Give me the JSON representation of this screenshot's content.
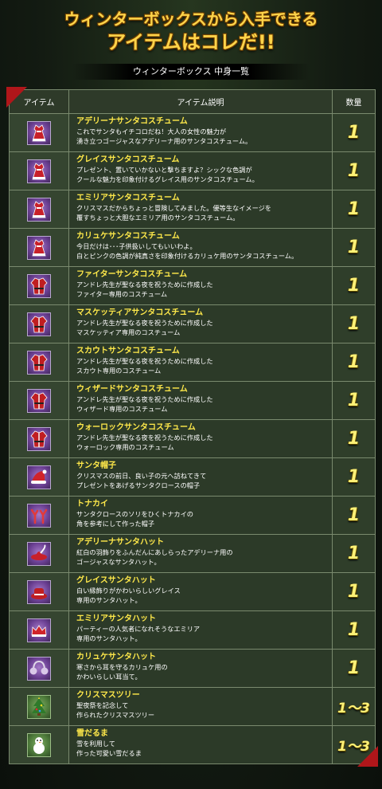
{
  "header": {
    "line1": "ウィンターボックスから入手できる",
    "line2": "アイテムはコレだ!!",
    "subtitle": "ウィンターボックス 中身一覧"
  },
  "table": {
    "col_icon": "アイテム",
    "col_desc": "アイテム説明",
    "col_qty": "数量",
    "rows": [
      {
        "name": "アデリーナサンタコスチューム",
        "d1": "これでサンタもイチコロだね！大人の女性の魅力が",
        "d2": "湧き立つゴージャスなアデリーナ用のサンタコスチューム。",
        "qty": "1",
        "icon": "dress-icon"
      },
      {
        "name": "グレイスサンタコスチューム",
        "d1": "プレゼント、置いていかないと撃ちますよ？シックな色調が",
        "d2": "クールな魅力を印象付けるグレイス用のサンタコスチューム。",
        "qty": "1",
        "icon": "dress-icon"
      },
      {
        "name": "エミリアサンタコスチューム",
        "d1": "クリスマスだからちょっと冒険してみました。優等生なイメージを",
        "d2": "覆すちょっと大胆なエミリア用のサンタコスチューム。",
        "qty": "1",
        "icon": "dress-icon"
      },
      {
        "name": "カリュケサンタコスチューム",
        "d1": "今日だけは･･･子供扱いしてもいいわよ。",
        "d2": "白とピンクの色調が純真さを印象付けるカリュケ用のサンタコスチューム。",
        "qty": "1",
        "icon": "dress-icon"
      },
      {
        "name": "ファイターサンタコスチューム",
        "d1": "アンドレ先生が聖なる夜を祝うために作成した",
        "d2": "ファイター専用のコスチューム",
        "qty": "1",
        "icon": "coat-icon"
      },
      {
        "name": "マスケッティアサンタコスチューム",
        "d1": "アンドレ先生が聖なる夜を祝うために作成した",
        "d2": "マスケッティア専用のコスチューム",
        "qty": "1",
        "icon": "coat-icon"
      },
      {
        "name": "スカウトサンタコスチューム",
        "d1": "アンドレ先生が聖なる夜を祝うために作成した",
        "d2": "スカウト専用のコスチューム",
        "qty": "1",
        "icon": "coat-icon"
      },
      {
        "name": "ウィザードサンタコスチューム",
        "d1": "アンドレ先生が聖なる夜を祝うために作成した",
        "d2": "ウィザード専用のコスチューム",
        "qty": "1",
        "icon": "coat-icon"
      },
      {
        "name": "ウォーロックサンタコスチューム",
        "d1": "アンドレ先生が聖なる夜を祝うために作成した",
        "d2": "ウォーロック専用のコスチューム",
        "qty": "1",
        "icon": "coat-icon"
      },
      {
        "name": "サンタ帽子",
        "d1": "クリスマスの前日、良い子の元へ訪ねてきて",
        "d2": "プレゼントをあげるサンタクロースの帽子",
        "qty": "1",
        "icon": "santa-hat-icon"
      },
      {
        "name": "トナカイ",
        "d1": "サンタクロースのソリをひくトナカイの",
        "d2": "角を参考にして作った帽子",
        "qty": "1",
        "icon": "antler-icon"
      },
      {
        "name": "アデリーナサンタハット",
        "d1": "紅白の羽飾りをふんだんにあしらったアデリーナ用の",
        "d2": "ゴージャスなサンタハット。",
        "qty": "1",
        "icon": "feather-hat-icon"
      },
      {
        "name": "グレイスサンタハット",
        "d1": "白い縁飾りがかわいらしいグレイス",
        "d2": "専用のサンタハット。",
        "qty": "1",
        "icon": "hat-icon"
      },
      {
        "name": "エミリアサンタハット",
        "d1": "パーティーの人気者になれそうなエミリア",
        "d2": "専用のサンタハット。",
        "qty": "1",
        "icon": "crown-hat-icon"
      },
      {
        "name": "カリュケサンタハット",
        "d1": "寒さから耳を守るカリュケ用の",
        "d2": "かわいらしい耳当て。",
        "qty": "1",
        "icon": "earmuff-icon"
      },
      {
        "name": "クリスマスツリー",
        "d1": "聖夜祭を記念して",
        "d2": "作られたクリスマスツリー",
        "qty": "1〜3",
        "icon": "tree-icon"
      },
      {
        "name": "雪だるま",
        "d1": "雪を利用して",
        "d2": "作った可愛い雪だるま",
        "qty": "1〜3",
        "icon": "snowman-icon"
      }
    ]
  },
  "colors": {
    "accent": "#ffd44a",
    "name": "#ffe94a",
    "corner": "#b0161a"
  }
}
